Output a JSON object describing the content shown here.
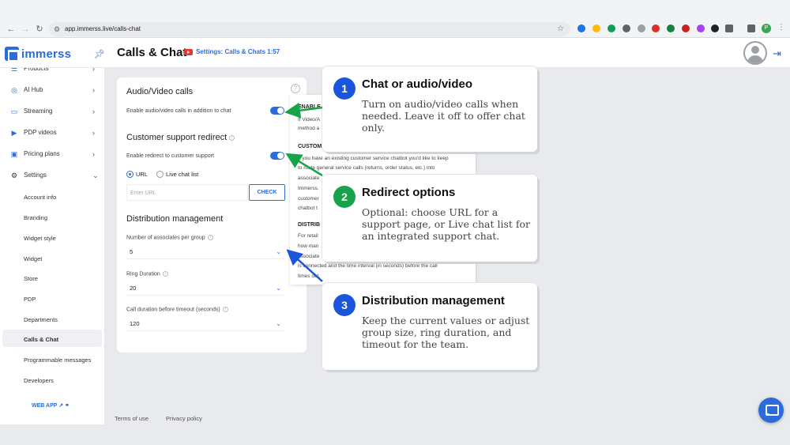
{
  "browser": {
    "url": "app.immerss.live/calls-chat",
    "profile_initial": "P"
  },
  "app": {
    "logo_text": "immerss",
    "page_title": "Calls & Chat",
    "video_pill": "Settings: Calls & Chats 1:57"
  },
  "sidebar": {
    "items": [
      {
        "label": "Products",
        "icon": "list-icon"
      },
      {
        "label": "AI Hub",
        "icon": "ai-icon"
      },
      {
        "label": "Streaming",
        "icon": "monitor-icon"
      },
      {
        "label": "PDP videos",
        "icon": "video-icon"
      },
      {
        "label": "Pricing plans",
        "icon": "card-icon"
      },
      {
        "label": "Settings",
        "icon": "gear-icon"
      }
    ],
    "sub_items": [
      "Account info",
      "Branding",
      "Widget style",
      "Widget",
      "Store",
      "PDP",
      "Departments",
      "Calls & Chat",
      "Programmable messages",
      "Developers"
    ],
    "active": "Calls & Chat",
    "web_app": "WEB APP"
  },
  "settings": {
    "av_title": "Audio/Video calls",
    "av_toggle_label": "Enable audio/video calls in addition to chat",
    "redirect_title": "Customer support redirect",
    "redirect_toggle_label": "Enable redirect to customer support",
    "radio_url": "URL",
    "radio_live": "Live chat list",
    "url_placeholder": "Enter URL",
    "check_label": "CHECK",
    "dist_title": "Distribution management",
    "assoc_label": "Number of associates per group",
    "assoc_value": "5",
    "ring_label": "Ring Duration",
    "ring_value": "20",
    "timeout_label": "Call duration before timeout (seconds)",
    "timeout_value": "120"
  },
  "help_panel": {
    "enable_head": "ENABLE",
    "enable_text": "If Video/A",
    "enable_text2": "method a",
    "custom_head": "CUSTOM",
    "custom_text1": "If you have an existing customer service chatbot you'd like to keep",
    "custom_text2": "to route general service calls (returns, order status, etc.) into",
    "custom_text3": "associate",
    "custom_text4": "Immerss.",
    "custom_text5": "customer",
    "custom_text6": "chatbot t",
    "dist_head": "DISTRIB",
    "dist_text1": "For retail",
    "dist_text2": "how man",
    "dist_text3": "associate",
    "dist_text4": "is connected and the time interval (in seconds) before the call",
    "dist_text5": "times out."
  },
  "callouts": [
    {
      "num": "1",
      "title": "Chat or audio/video",
      "body": "Turn on audio/video calls when needed. Leave it off to offer chat only.",
      "color": "#1a56db"
    },
    {
      "num": "2",
      "title": "Redirect options",
      "body": "Optional: choose URL for a support page, or Live chat list for an integrated support chat.",
      "color": "#16a34a"
    },
    {
      "num": "3",
      "title": "Distribution management",
      "body": "Keep the current values or adjust group size, ring duration, and timeout for the team.",
      "color": "#1a56db"
    }
  ],
  "footer": {
    "terms": "Terms of use",
    "privacy": "Privacy policy"
  }
}
